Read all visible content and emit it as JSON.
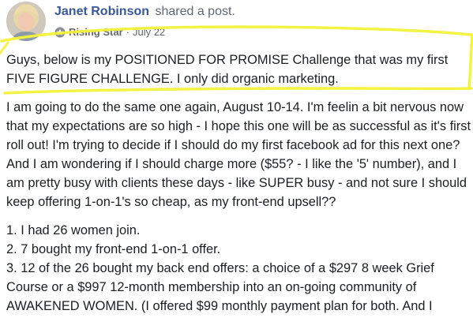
{
  "post": {
    "author": "Janet Robinson",
    "action": "shared a post.",
    "badge": "Rising Star",
    "separator": "·",
    "date": "July 22",
    "avatar_icon": "profile-photo",
    "badge_icon": "star-badge-icon",
    "paragraphs": [
      "Guys, below is my POSITIONED FOR PROMISE Challenge that was my first FIVE FIGURE CHALLENGE. I only did organic marketing.",
      "I am going to do the same one again, August 10-14. I'm feelin a bit nervous now that my expectations are so high - I hope this one will be as successful as it's first roll out! I'm trying to decide if I should do my first facebook ad for this next one? And I am wondering if I should charge more ($55? - I like the '5' number), and I am pretty busy with clients these days - like SUPER busy - and not sure I should keep offering 1-on-1's so cheap, as my front-end upsell??"
    ],
    "list_items": [
      "1. I had 26 women join.",
      "2. 7 bought my front-end 1-on-1 offer.",
      "3. 12 of the 26 bought my back end offers: a choice of a $297 8 week Grief Course or a $997 12-month membership into an on-going community of AWAKENED WOMEN. (I offered $99 monthly payment plan for both. And I"
    ]
  },
  "colors": {
    "author_link": "#385898",
    "meta_gray": "#606770",
    "text": "#1c1e21",
    "highlight": "#f2f23a"
  }
}
